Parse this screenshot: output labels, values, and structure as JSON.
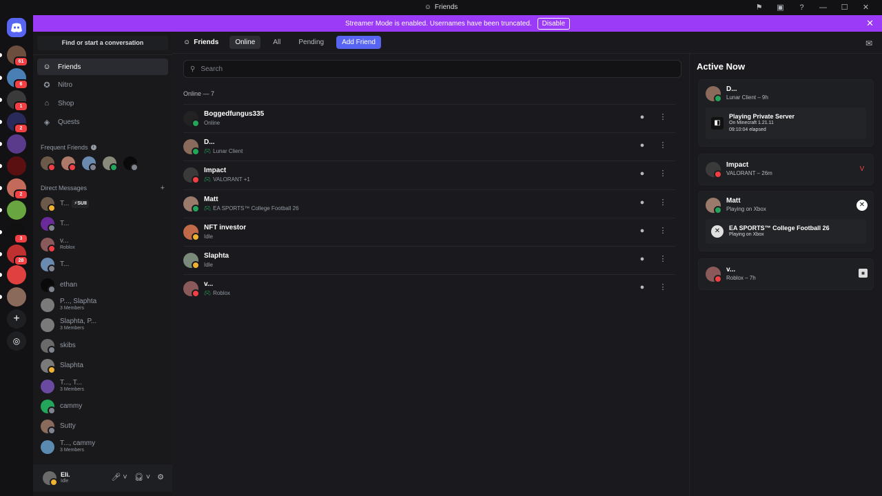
{
  "window": {
    "title": "Friends"
  },
  "banner": {
    "text": "Streamer Mode is enabled. Usernames have been truncated.",
    "disable_label": "Disable"
  },
  "servers": [
    {
      "color": "#6b4e3d",
      "badge": "61"
    },
    {
      "color": "#4a7fb5",
      "badge": "6"
    },
    {
      "color": "#3a3a3a",
      "badge": "1"
    },
    {
      "color": "#2a2a5a",
      "badge": "2"
    },
    {
      "color": "#5a3a8a",
      "badge": ""
    },
    {
      "color": "#5a1010",
      "badge": ""
    },
    {
      "color": "#c46a5a",
      "badge": "2"
    },
    {
      "color": "#6aa640",
      "badge": ""
    },
    {
      "color": "#111111",
      "badge": "3"
    },
    {
      "color": "#c03030",
      "badge": "28"
    },
    {
      "color": "#e04040",
      "badge": ""
    },
    {
      "color": "#8a6a5a",
      "badge": ""
    }
  ],
  "dm_sidebar": {
    "find_label": "Find or start a conversation",
    "nav": [
      {
        "label": "Friends",
        "icon": "friends-icon"
      },
      {
        "label": "Nitro",
        "icon": "nitro-icon"
      },
      {
        "label": "Shop",
        "icon": "shop-icon"
      },
      {
        "label": "Quests",
        "icon": "quests-icon"
      }
    ],
    "frequent_label": "Frequent Friends",
    "dm_label": "Direct Messages",
    "dms": [
      {
        "name": "T...",
        "tag": "⚡SUII",
        "sub": ""
      },
      {
        "name": "T...",
        "tag": "",
        "sub": ""
      },
      {
        "name": "v...",
        "tag": "",
        "sub": "Roblox"
      },
      {
        "name": "T...",
        "tag": "",
        "sub": ""
      },
      {
        "name": "ethan",
        "tag": "",
        "sub": ""
      },
      {
        "name": "P..., Slaphta",
        "tag": "",
        "sub": "3 Members"
      },
      {
        "name": "Slaphta, P...",
        "tag": "",
        "sub": "3 Members"
      },
      {
        "name": "skibs",
        "tag": "",
        "sub": ""
      },
      {
        "name": "Slaphta",
        "tag": "",
        "sub": ""
      },
      {
        "name": "T..., T...",
        "tag": "",
        "sub": "3 Members"
      },
      {
        "name": "cammy",
        "tag": "",
        "sub": ""
      },
      {
        "name": "Sutty",
        "tag": "",
        "sub": ""
      },
      {
        "name": "T..., cammy",
        "tag": "",
        "sub": "3 Members"
      }
    ]
  },
  "user": {
    "name": "Eli.",
    "status": "Idle"
  },
  "topbar": {
    "title": "Friends",
    "tabs": [
      "Online",
      "All",
      "Pending"
    ],
    "add_friend": "Add Friend"
  },
  "search": {
    "placeholder": "Search"
  },
  "online_count": "Online — 7",
  "friends": [
    {
      "name": "Boggedfungus335",
      "sub": "Online",
      "game": false,
      "status": "online"
    },
    {
      "name": "D...",
      "sub": "Lunar Client",
      "game": true,
      "status": "online"
    },
    {
      "name": "Impact",
      "sub": "VALORANT +1",
      "game": true,
      "status": "dnd"
    },
    {
      "name": "Matt",
      "sub": "EA SPORTS™ College Football 26",
      "game": true,
      "status": "online"
    },
    {
      "name": "NFT investor",
      "sub": "Idle",
      "game": false,
      "status": "idle"
    },
    {
      "name": "Slaphta",
      "sub": "Idle",
      "game": false,
      "status": "idle"
    },
    {
      "name": "v...",
      "sub": "Roblox",
      "game": true,
      "status": "dnd"
    }
  ],
  "active_now": {
    "title": "Active Now",
    "cards": [
      {
        "name": "D...",
        "sub": "Lunar Client – 9h",
        "activity": {
          "title": "Playing Private Server",
          "line1": "On Minecraft 1.21.11",
          "line2": "09:10:04 elapsed"
        }
      },
      {
        "name": "Impact",
        "sub": "VALORANT – 26m"
      },
      {
        "name": "Matt",
        "sub": "Playing on Xbox",
        "activity": {
          "title": "EA SPORTS™ College Football 26",
          "line1": "Playing on Xbox",
          "line2": ""
        }
      },
      {
        "name": "v...",
        "sub": "Roblox – 7h"
      }
    ]
  }
}
